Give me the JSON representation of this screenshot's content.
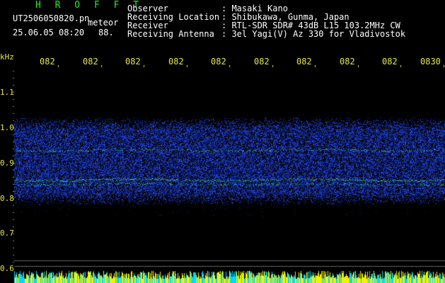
{
  "header": {
    "app_name": "H R O F F T",
    "filename": "UT2506050820.pn",
    "meteor_label": "meteor",
    "date_time": "25.06.05 08:20",
    "count": "88.",
    "info_labels": [
      "Observer",
      "Receiving Location",
      "Receiver",
      "Receiving Antenna"
    ],
    "info_values": [
      ": Masaki Kano",
      ": Shibukawa, Gunma, Japan",
      ": RTL-SDR SDR# 43dB L15 103.2MHz CW",
      ": 3el Yagi(V) Az 330 for Vladivostok"
    ]
  },
  "axis": {
    "unit": "kHz",
    "y_ticks": [
      "1.1",
      "1.0",
      "0.9",
      "0.8",
      "0.7",
      "0.6"
    ],
    "x_ticks": [
      "082",
      "082",
      "082",
      "082",
      "082",
      "082",
      "082",
      "082",
      "082",
      "0830"
    ]
  },
  "colors": {
    "header_green": "#2ee82e",
    "label_yellow": "#e6e64a",
    "noise_blue": "#1f3fff",
    "signal_green": "#3cff3c",
    "bottom_yellow": "#f2f200",
    "bottom_cyan": "#00d8ff"
  }
}
